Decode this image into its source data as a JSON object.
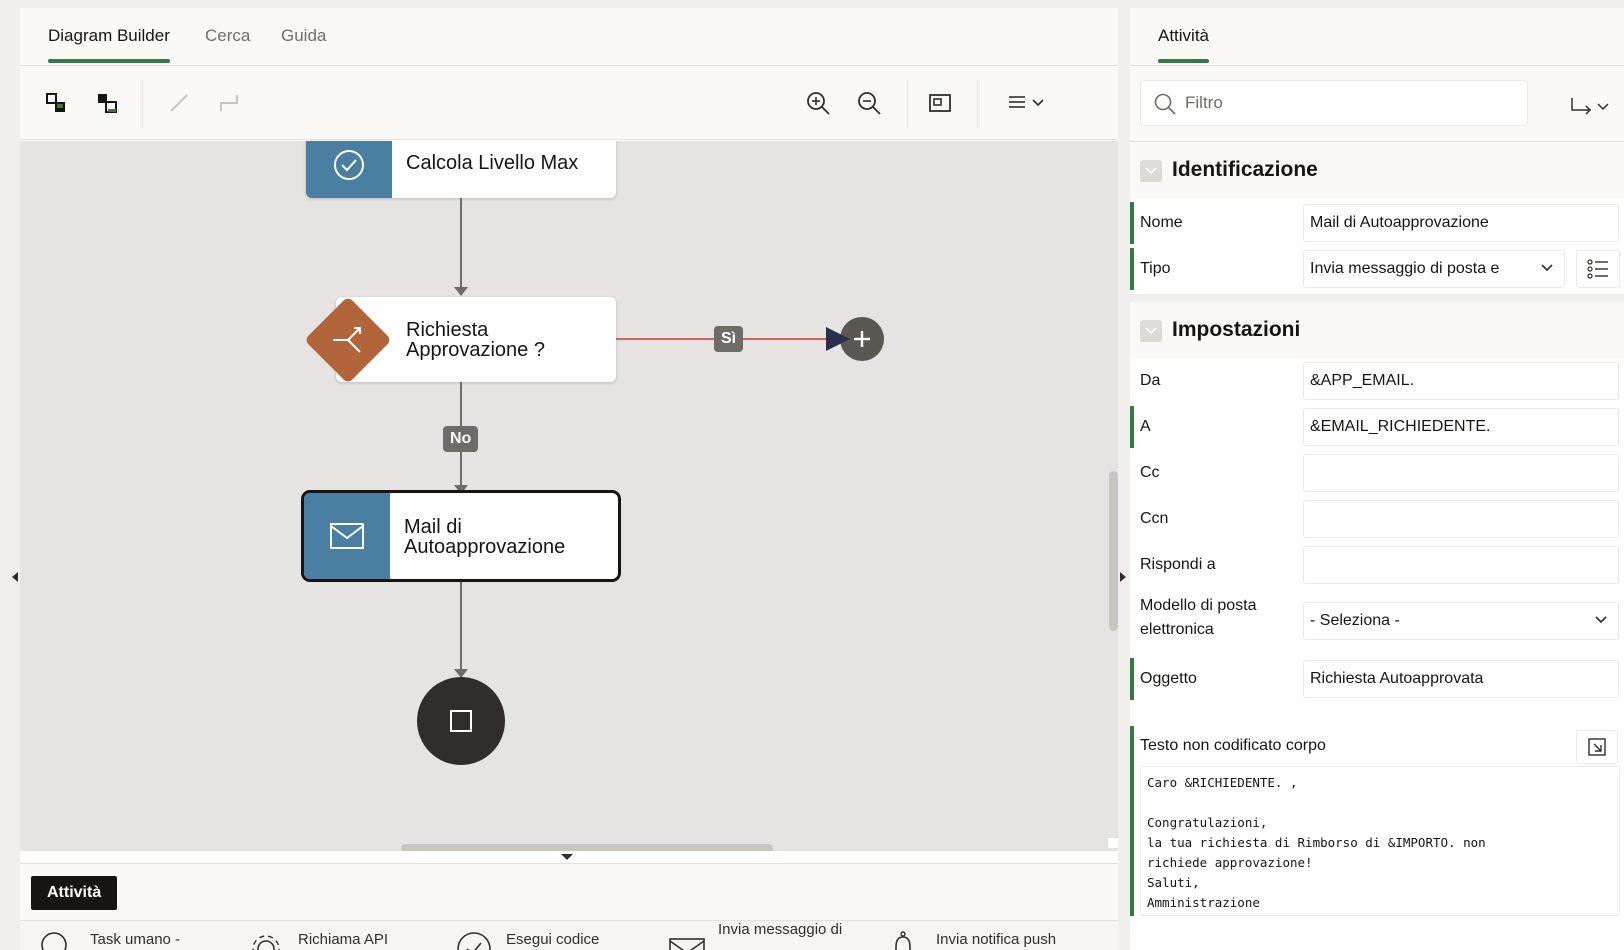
{
  "left_tabs": [
    {
      "label": "Diagram Builder",
      "active": true
    },
    {
      "label": "Cerca",
      "active": false
    },
    {
      "label": "Guida",
      "active": false
    }
  ],
  "toolbar": {
    "buttons": [
      "arrange-icon",
      "arrange-alt-icon",
      "straight-link-icon",
      "elbow-link-icon",
      "zoom-in-icon",
      "zoom-out-icon",
      "fit-to-screen-icon",
      "menu-icon"
    ]
  },
  "diagram": {
    "nodes": {
      "calc": {
        "label": "Calcola Livello Max",
        "icon": "check-circle-icon"
      },
      "gateway": {
        "line1": "Richiesta",
        "line2": "Approvazione ?",
        "icon": "split-icon"
      },
      "mail": {
        "line1": "Mail di",
        "line2": "Autoapprovazione",
        "icon": "envelope-icon",
        "selected": true
      },
      "end": {
        "icon": "stop-icon"
      }
    },
    "links": {
      "yes_label": "Sì",
      "no_label": "No"
    }
  },
  "palette": {
    "title": "Attività",
    "items": [
      {
        "label": "Task umano -",
        "icon": "human-task-icon"
      },
      {
        "label": "Richiama API",
        "icon": "gear-icon"
      },
      {
        "label": "Esegui codice",
        "icon": "code-icon"
      },
      {
        "label": "Invia messaggio di",
        "icon": "envelope-icon"
      },
      {
        "label": "Invia notifica push",
        "icon": "bell-icon"
      }
    ]
  },
  "right": {
    "tab": "Attività",
    "filter_placeholder": "Filtro",
    "sections": {
      "identificazione": "Identificazione",
      "impostazioni": "Impostazioni"
    },
    "fields": {
      "nome": {
        "label": "Nome",
        "value": "Mail di Autoapprovazione"
      },
      "tipo": {
        "label": "Tipo",
        "value": "Invia messaggio di posta e"
      },
      "da": {
        "label": "Da",
        "value": "&APP_EMAIL."
      },
      "a": {
        "label": "A",
        "value": "&EMAIL_RICHIEDENTE."
      },
      "cc": {
        "label": "Cc",
        "value": ""
      },
      "ccn": {
        "label": "Ccn",
        "value": ""
      },
      "rispondi": {
        "label": "Rispondi a",
        "value": ""
      },
      "modello": {
        "label_line1": "Modello di posta",
        "label_line2": "elettronica",
        "value": "- Seleziona -"
      },
      "oggetto": {
        "label": "Oggetto",
        "value": "Richiesta Autoapprovata"
      },
      "corpo": {
        "label": "Testo non codificato corpo",
        "value": "Caro &RICHIEDENTE. ,\n\nCongratulazioni,\nla tua richiesta di Rimborso di &IMPORTO. non\nrichiede approvazione!\nSaluti,\nAmministrazione"
      }
    }
  },
  "colors": {
    "accent_green": "#357a43",
    "activity_blue": "#4a7fa1",
    "gateway_brown": "#b2643a",
    "link_red": "#d0645c",
    "end_dark": "#312d2a"
  }
}
